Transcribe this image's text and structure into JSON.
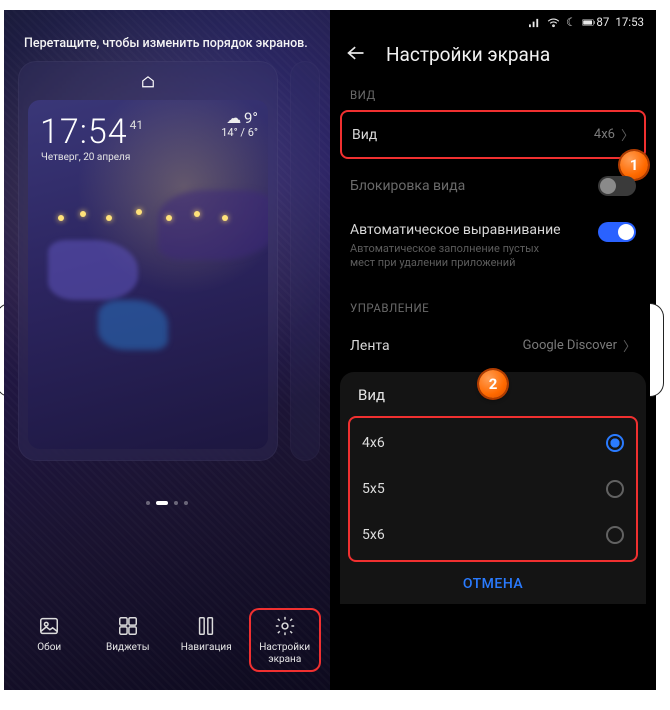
{
  "left": {
    "hint": "Перетащите, чтобы изменить порядок экранов.",
    "clock": "17:54",
    "clock_sub": "41",
    "date": "Четверг, 20 апреля",
    "weather": {
      "temp": "9°",
      "low_high": "14° / 6°",
      "icon": "☁"
    },
    "actions": [
      {
        "label": "Обои",
        "icon": "wallpaper"
      },
      {
        "label": "Виджеты",
        "icon": "widgets"
      },
      {
        "label": "Навигация",
        "icon": "navigation"
      },
      {
        "label": "Настройки\nэкрана",
        "icon": "gear",
        "active": true
      }
    ]
  },
  "right": {
    "status": {
      "battery": "87",
      "time": "17:53"
    },
    "title": "Настройки экрана",
    "sections": {
      "view_label": "ВИД",
      "manage_label": "УПРАВЛЕНИЕ"
    },
    "rows": {
      "view": {
        "label": "Вид",
        "value": "4x6"
      },
      "lock": {
        "label": "Блокировка вида",
        "on": false
      },
      "align": {
        "label": "Автоматическое выравнивание",
        "sub": "Автоматическое заполнение пустых мест при удалении приложений",
        "on": true
      },
      "feed": {
        "label": "Лента",
        "value": "Google Discover"
      }
    },
    "sheet": {
      "title": "Вид",
      "options": [
        "4x6",
        "5x5",
        "5x6"
      ],
      "selected": "4x6",
      "cancel": "ОТМЕНА"
    }
  },
  "callouts": {
    "one": "1",
    "two": "2"
  }
}
